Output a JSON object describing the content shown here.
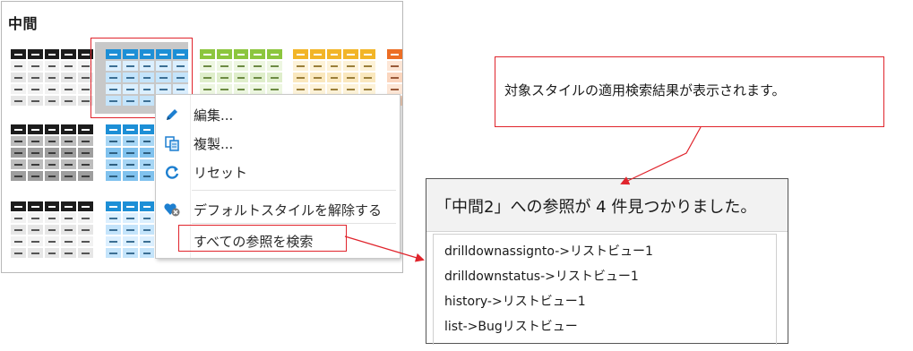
{
  "panel": {
    "title": "中間",
    "swatch_colors": [
      {
        "name": "black",
        "header": "#1c1c1c",
        "dash_header": "#ffffff",
        "rows": [
          "#f2f2f2",
          "#e6e6e6",
          "#f2f2f2",
          "#e6e6e6"
        ],
        "dash": "#555555"
      },
      {
        "name": "blue",
        "header": "#1d8fd6",
        "dash_header": "#ffffff",
        "rows": [
          "#dbefff",
          "#c4e4fb",
          "#dbefff",
          "#c4e4fb"
        ],
        "dash": "#3c6f94"
      },
      {
        "name": "green",
        "header": "#8cc63e",
        "dash_header": "#ffffff",
        "rows": [
          "#edf6e1",
          "#dfeecb",
          "#edf6e1",
          "#dfeecb"
        ],
        "dash": "#6d8b44"
      },
      {
        "name": "yellow",
        "header": "#f2b527",
        "dash_header": "#ffffff",
        "rows": [
          "#fdf2d8",
          "#fae8be",
          "#fdf2d8",
          "#fae8be"
        ],
        "dash": "#9b7f3a"
      },
      {
        "name": "orange",
        "header": "#ec6e25",
        "dash_header": "#ffffff",
        "rows": [
          "#fde6d6",
          "#fbd6be",
          "#fde6d6",
          "#fbd6be"
        ],
        "dash": "#9a5a3a"
      },
      {
        "name": "gray-black",
        "header": "#1c1c1c",
        "dash_header": "#ffffff",
        "rows": [
          "#bdbdbd",
          "#9e9e9e",
          "#bdbdbd",
          "#9e9e9e"
        ],
        "dash": "#3a3a3a"
      },
      {
        "name": "blue-mid",
        "header": "#1d8fd6",
        "dash_header": "#ffffff",
        "rows": [
          "#a7d6f5",
          "#80c2ee",
          "#a7d6f5",
          "#80c2ee"
        ],
        "dash": "#2e5f80"
      }
    ]
  },
  "context_menu": {
    "items": [
      {
        "label": "編集...",
        "icon": "pencil-icon"
      },
      {
        "label": "複製...",
        "icon": "duplicate-icon"
      },
      {
        "label": "リセット",
        "icon": "reset-icon"
      },
      {
        "label": "デフォルトスタイルを解除する",
        "icon": "remove-default-icon"
      },
      {
        "label": "すべての参照を検索",
        "icon": ""
      }
    ]
  },
  "callout": {
    "text": "対象スタイルの適用検索結果が表示されます。"
  },
  "results": {
    "title": "「中間2」への参照が 4 件見つかりました。",
    "items": [
      "drilldownassignto->リストビュー1",
      "drilldownstatus->リストビュー1",
      "history->リストビュー1",
      "list->Bugリストビュー"
    ]
  },
  "colors": {
    "accent_red": "#e0242c",
    "menu_icon_blue": "#1d7fd0"
  }
}
